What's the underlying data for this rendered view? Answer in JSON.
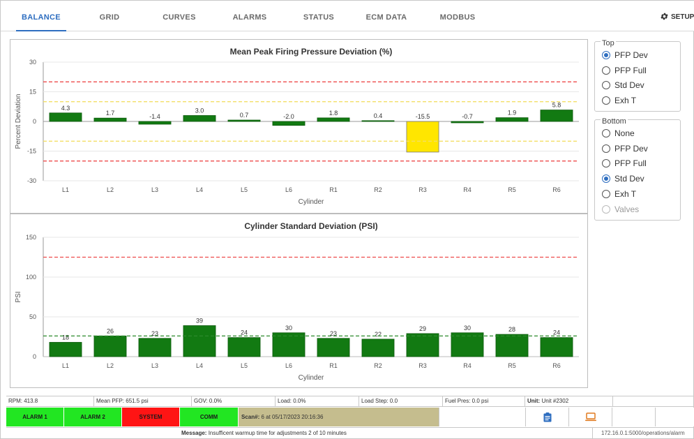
{
  "nav": {
    "tabs": [
      {
        "label": "BALANCE",
        "active": true
      },
      {
        "label": "GRID",
        "active": false
      },
      {
        "label": "CURVES",
        "active": false
      },
      {
        "label": "ALARMS",
        "active": false
      },
      {
        "label": "STATUS",
        "active": false
      },
      {
        "label": "ECM DATA",
        "active": false
      },
      {
        "label": "MODBUS",
        "active": false
      }
    ],
    "setup_label": "SETUP",
    "setup_icon": "gear-icon"
  },
  "colors": {
    "bar_green": "#127a12",
    "bar_alert": "#ffe600",
    "limit_red": "#ee4c4c",
    "limit_yellow": "#f3df66",
    "mean_green": "#2c8a2c",
    "accent": "#2e6ec0",
    "alarm_ok": "#22e622",
    "alarm_fault": "#ff1414"
  },
  "chart_data": [
    {
      "type": "bar",
      "title": "Mean Peak Firing Pressure Deviation (%)",
      "xlabel": "Cylinder",
      "ylabel": "Percent Deviation",
      "categories": [
        "L1",
        "L2",
        "L3",
        "L4",
        "L5",
        "L6",
        "R1",
        "R2",
        "R3",
        "R4",
        "R5",
        "R6"
      ],
      "values": [
        4.3,
        1.7,
        -1.4,
        3.0,
        0.7,
        -2.0,
        1.8,
        0.4,
        -15.5,
        -0.7,
        1.9,
        5.8
      ],
      "value_labels": [
        "4.3",
        "1.7",
        "-1.4",
        "3.0",
        "0.7",
        "-2.0",
        "1.8",
        "0.4",
        "-15.5",
        "-0.7",
        "1.9",
        "5.8"
      ],
      "highlight_index": 8,
      "ylim": [
        -30,
        30
      ],
      "yticks": [
        30,
        15,
        0,
        -15,
        -30
      ],
      "reference_lines": [
        {
          "value": 20,
          "color": "red"
        },
        {
          "value": -20,
          "color": "red"
        },
        {
          "value": 10,
          "color": "yellow"
        },
        {
          "value": -10,
          "color": "yellow"
        }
      ]
    },
    {
      "type": "bar",
      "title": "Cylinder Standard Deviation (PSI)",
      "xlabel": "Cylinder",
      "ylabel": "PSI",
      "categories": [
        "L1",
        "L2",
        "L3",
        "L4",
        "L5",
        "L6",
        "R1",
        "R2",
        "R3",
        "R4",
        "R5",
        "R6"
      ],
      "values": [
        18,
        26,
        23,
        39,
        24,
        30,
        23,
        22,
        29,
        30,
        28,
        24
      ],
      "value_labels": [
        "18",
        "26",
        "23",
        "39",
        "24",
        "30",
        "23",
        "22",
        "29",
        "30",
        "28",
        "24"
      ],
      "ylim": [
        0,
        150
      ],
      "yticks": [
        150,
        100,
        50,
        0
      ],
      "reference_lines": [
        {
          "value": 125,
          "color": "red"
        },
        {
          "value": 26,
          "color": "green"
        }
      ]
    }
  ],
  "top_group": {
    "title": "Top",
    "options": [
      {
        "label": "PFP Dev",
        "checked": true
      },
      {
        "label": "PFP Full",
        "checked": false
      },
      {
        "label": "Std Dev",
        "checked": false
      },
      {
        "label": "Exh T",
        "checked": false
      }
    ]
  },
  "bottom_group": {
    "title": "Bottom",
    "options": [
      {
        "label": "None",
        "checked": false
      },
      {
        "label": "PFP Dev",
        "checked": false
      },
      {
        "label": "PFP Full",
        "checked": false
      },
      {
        "label": "Std Dev",
        "checked": true
      },
      {
        "label": "Exh T",
        "checked": false
      },
      {
        "label": "Valves",
        "checked": false,
        "disabled": true
      }
    ]
  },
  "status": {
    "rpm": "RPM: 413.8",
    "mean_pfp": "Mean PFP: 651.5 psi",
    "gov": "GOV: 0.0%",
    "load": "Load: 0.0%",
    "load_step": "Load Step: 0.0",
    "fuel_pres": "Fuel Pres: 0.0 psi",
    "unit_label": "Unit:",
    "unit_value": "Unit #2302"
  },
  "alarms": {
    "alarm1": "ALARM 1",
    "alarm2": "ALARM 2",
    "system": "SYSTEM",
    "comm": "COMM",
    "scan_label": "Scan#:",
    "scan_value": "6 at 05/17/2023 20:16:36",
    "report_icon": "clipboard-icon",
    "laptop_icon": "laptop-icon"
  },
  "message": {
    "label": "Message:",
    "text": "Insufficent warmup time for adjustments 2 of 10 minutes",
    "url": "172.16.0.1:5000/operations/alarm"
  }
}
